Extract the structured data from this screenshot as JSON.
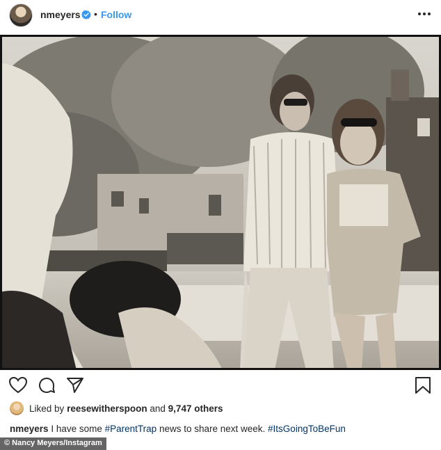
{
  "post": {
    "username": "nmeyers",
    "dot": "•",
    "follow_label": "Follow",
    "likes_prefix": "Liked by",
    "liked_by_user": "reesewitherspoon",
    "likes_and": "and",
    "likes_count": "9,747 others",
    "caption_user": "nmeyers",
    "caption_text_1": "I have some",
    "caption_tag_1": "#ParentTrap",
    "caption_text_2": "news to share next week.",
    "caption_tag_2": "#ItsGoingToBeFun"
  },
  "photo_credit": "© Nancy Meyers/Instagram",
  "colors": {
    "link": "#3897f0",
    "hashtag": "#003569",
    "verified": "#3897f0"
  },
  "icons": [
    "verified-badge-icon",
    "more-options-icon",
    "heart-icon",
    "comment-icon",
    "share-icon",
    "bookmark-icon"
  ]
}
